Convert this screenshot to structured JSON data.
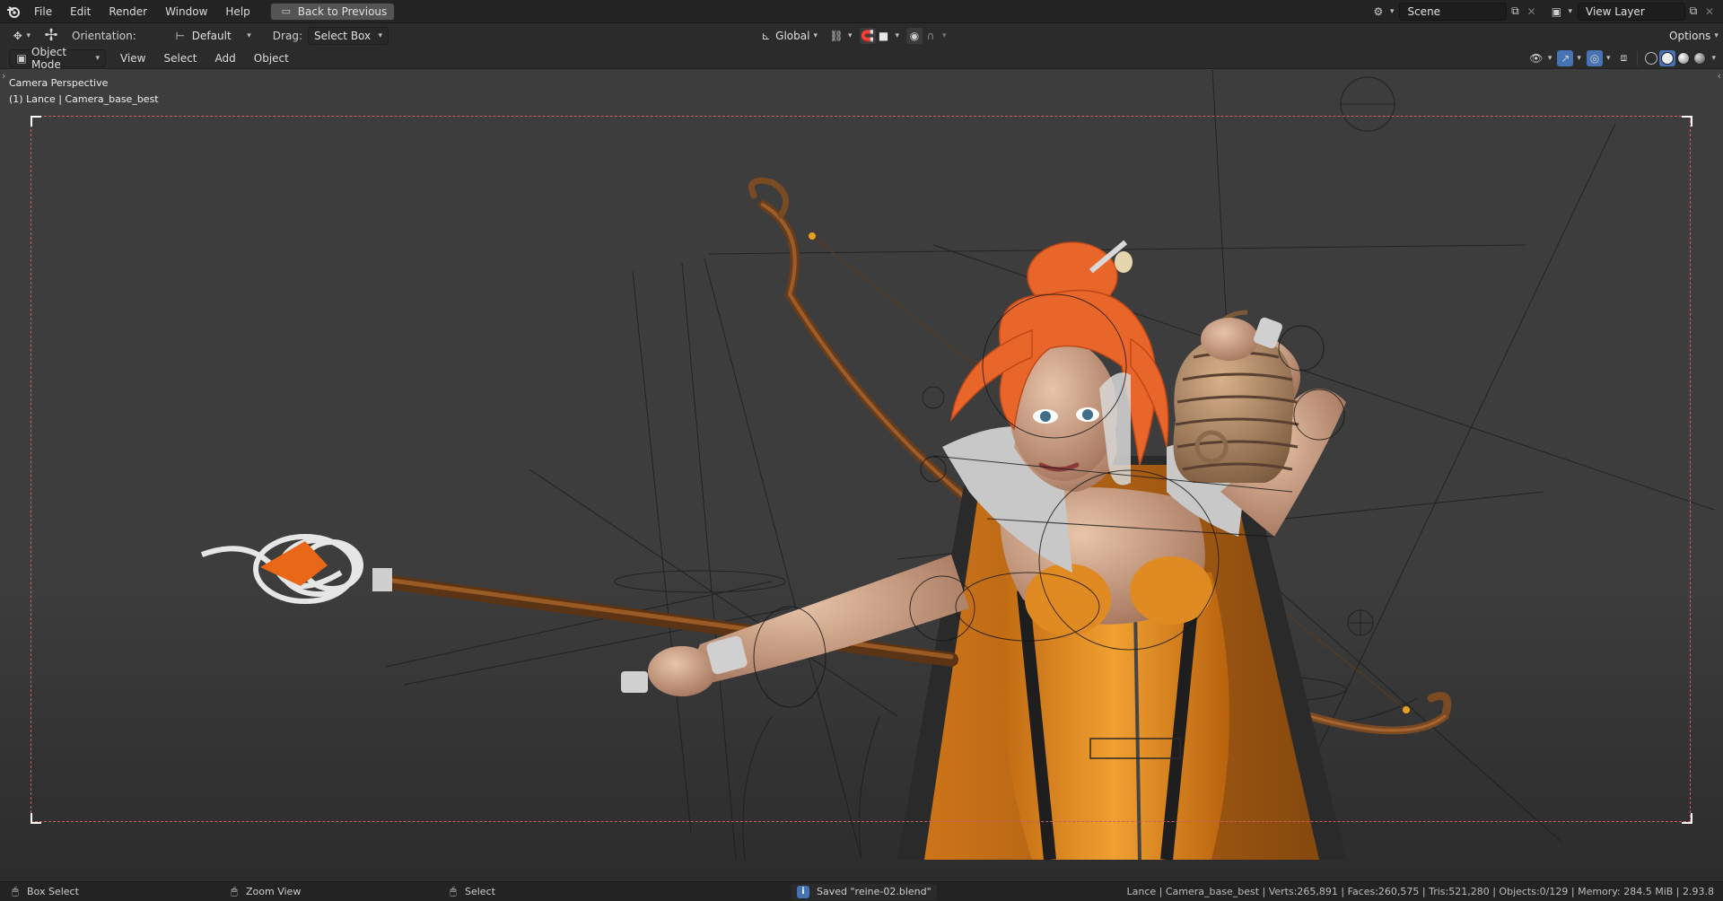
{
  "menus": [
    "File",
    "Edit",
    "Render",
    "Window",
    "Help"
  ],
  "back_button": "Back to Previous",
  "scene": {
    "value": "Scene"
  },
  "view_layer": {
    "value": "View Layer"
  },
  "toolbar": {
    "orientation_label": "Orientation:",
    "orientation_value": "Default",
    "drag_label": "Drag:",
    "drag_value": "Select Box",
    "transform_space": "Global",
    "options_label": "Options"
  },
  "header": {
    "mode": "Object Mode",
    "view": "View",
    "select": "Select",
    "add": "Add",
    "object": "Object"
  },
  "viewport": {
    "perspective": "Camera Perspective",
    "active_object": "(1) Lance | Camera_base_best"
  },
  "statusbar": {
    "box_select": "Box Select",
    "zoom_view": "Zoom View",
    "select": "Select",
    "saved_message": "Saved \"reine-02.blend\"",
    "scene_stats": "Lance | Camera_base_best | Verts:265,891 | Faces:260,575 | Tris:521,280 | Objects:0/129 | Memory: 284.5 MiB | 2.93.8"
  },
  "colors": {
    "accent": "#4772b3",
    "hair": "#e8662a",
    "dress": "#e8922a",
    "wood": "#7a4a22",
    "metal": "#d9d9d9"
  },
  "icons": [
    "blender-logo-icon",
    "transform-tool-icon",
    "move-gizmo-icon",
    "snap-icon",
    "proportional-icon",
    "overlay-icon",
    "gizmo-icon",
    "xray-icon",
    "shading-wireframe-icon",
    "shading-solid-icon",
    "shading-material-icon",
    "shading-rendered-icon",
    "info-icon",
    "mouse-left-icon",
    "mouse-middle-icon",
    "mouse-right-icon"
  ]
}
